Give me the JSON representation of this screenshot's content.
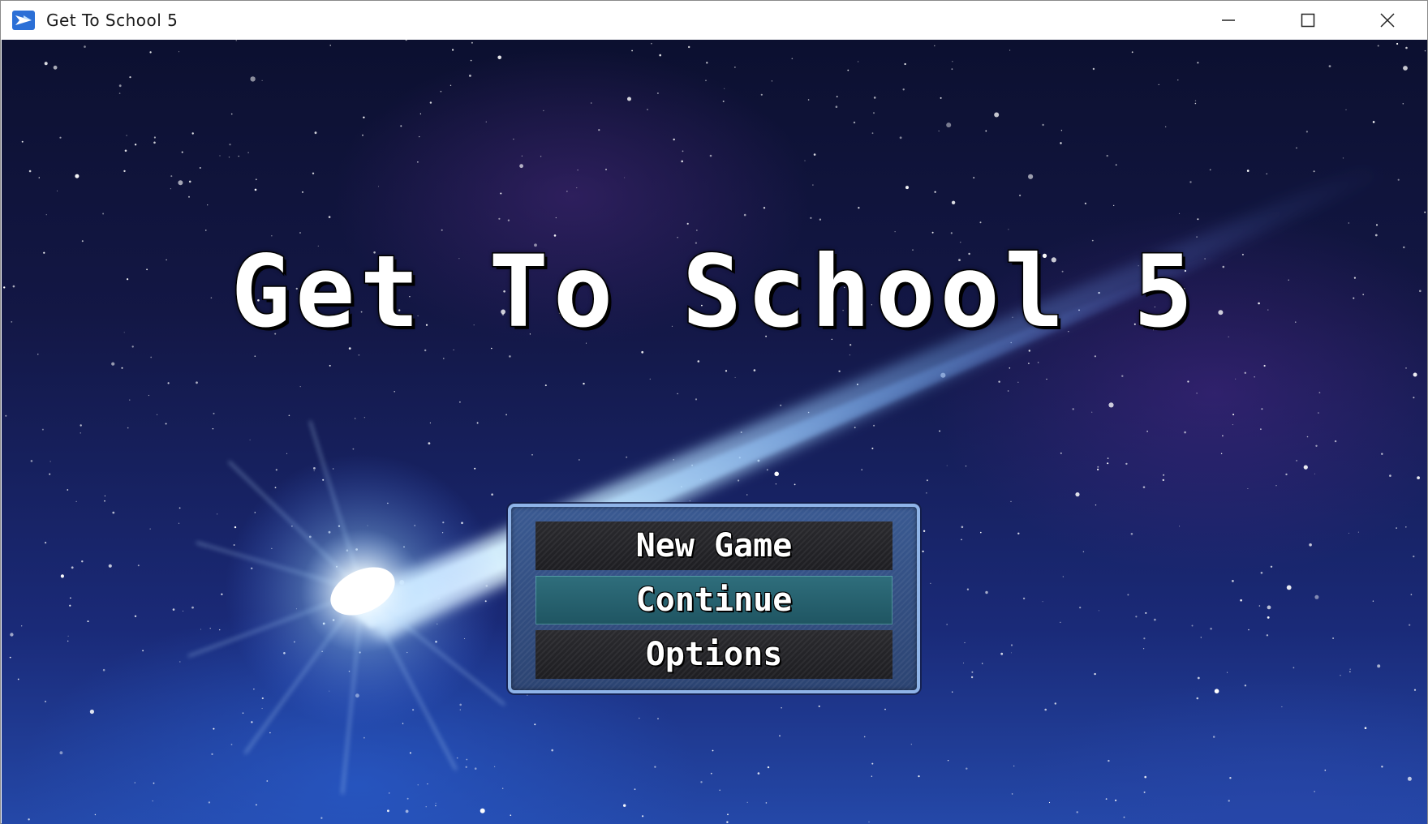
{
  "window": {
    "title": "Get To School 5",
    "icons": {
      "app": "rpg-maker-app-icon",
      "minimize": "minimize-icon",
      "maximize": "maximize-icon",
      "close": "close-icon"
    }
  },
  "game": {
    "title": "Get To School 5",
    "background": "starry-space-with-comet",
    "menu": {
      "items": [
        {
          "label": "New Game",
          "selected": false
        },
        {
          "label": "Continue",
          "selected": true
        },
        {
          "label": "Options",
          "selected": false
        }
      ]
    }
  },
  "colors": {
    "menu_border": "#8fb4e8",
    "menu_selected": "#2f6e7c",
    "title_text": "#ffffff"
  }
}
